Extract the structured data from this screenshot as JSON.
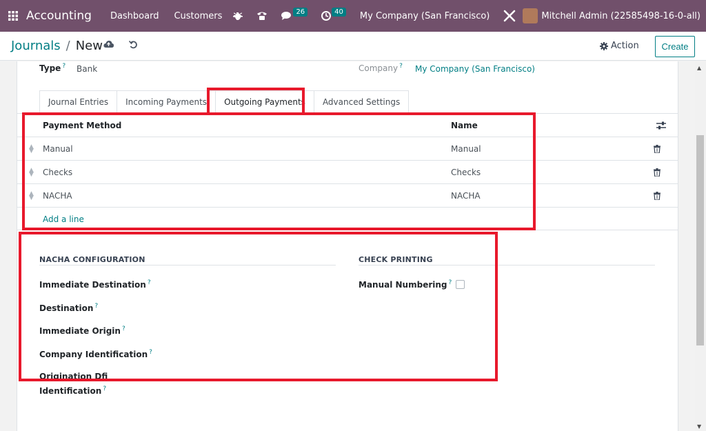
{
  "navbar": {
    "app_name": "Accounting",
    "menus": [
      "Dashboard",
      "Customers"
    ],
    "plus_icon": "plus-icon",
    "messages_count": "26",
    "activities_count": "40",
    "company": "My Company (San Francisco)",
    "user": "Mitchell Admin (22585498-16-0-all)"
  },
  "breadcrumb": {
    "parent": "Journals",
    "separator": "/",
    "current": "New"
  },
  "control": {
    "action_label": "Action",
    "create_label": "Create"
  },
  "form": {
    "type_label": "Type",
    "type_value": "Bank",
    "help_mark": "?",
    "company_label": "Company",
    "company_value": "My Company (San Francisco)"
  },
  "tabs": [
    {
      "label": "Journal Entries"
    },
    {
      "label": "Incoming Payments"
    },
    {
      "label": "Outgoing Payments"
    },
    {
      "label": "Advanced Settings"
    }
  ],
  "active_tab": "Outgoing Payments",
  "payment_table": {
    "headers": [
      "Payment Method",
      "Name"
    ],
    "rows": [
      {
        "method": "Manual",
        "name": "Manual"
      },
      {
        "method": "Checks",
        "name": "Checks"
      },
      {
        "method": "NACHA",
        "name": "NACHA"
      }
    ],
    "add_line": "Add a line"
  },
  "nacha": {
    "title": "NACHA CONFIGURATION",
    "fields": [
      "Immediate Destination",
      "Destination",
      "Immediate Origin",
      "Company Identification",
      "Origination Dfi",
      "Identification"
    ]
  },
  "check_printing": {
    "title": "CHECK PRINTING",
    "manual_numbering_label": "Manual Numbering",
    "manual_numbering_checked": false
  },
  "colors": {
    "navbar": "#71506b",
    "accent": "#017e84",
    "highlight": "#e8192c"
  }
}
